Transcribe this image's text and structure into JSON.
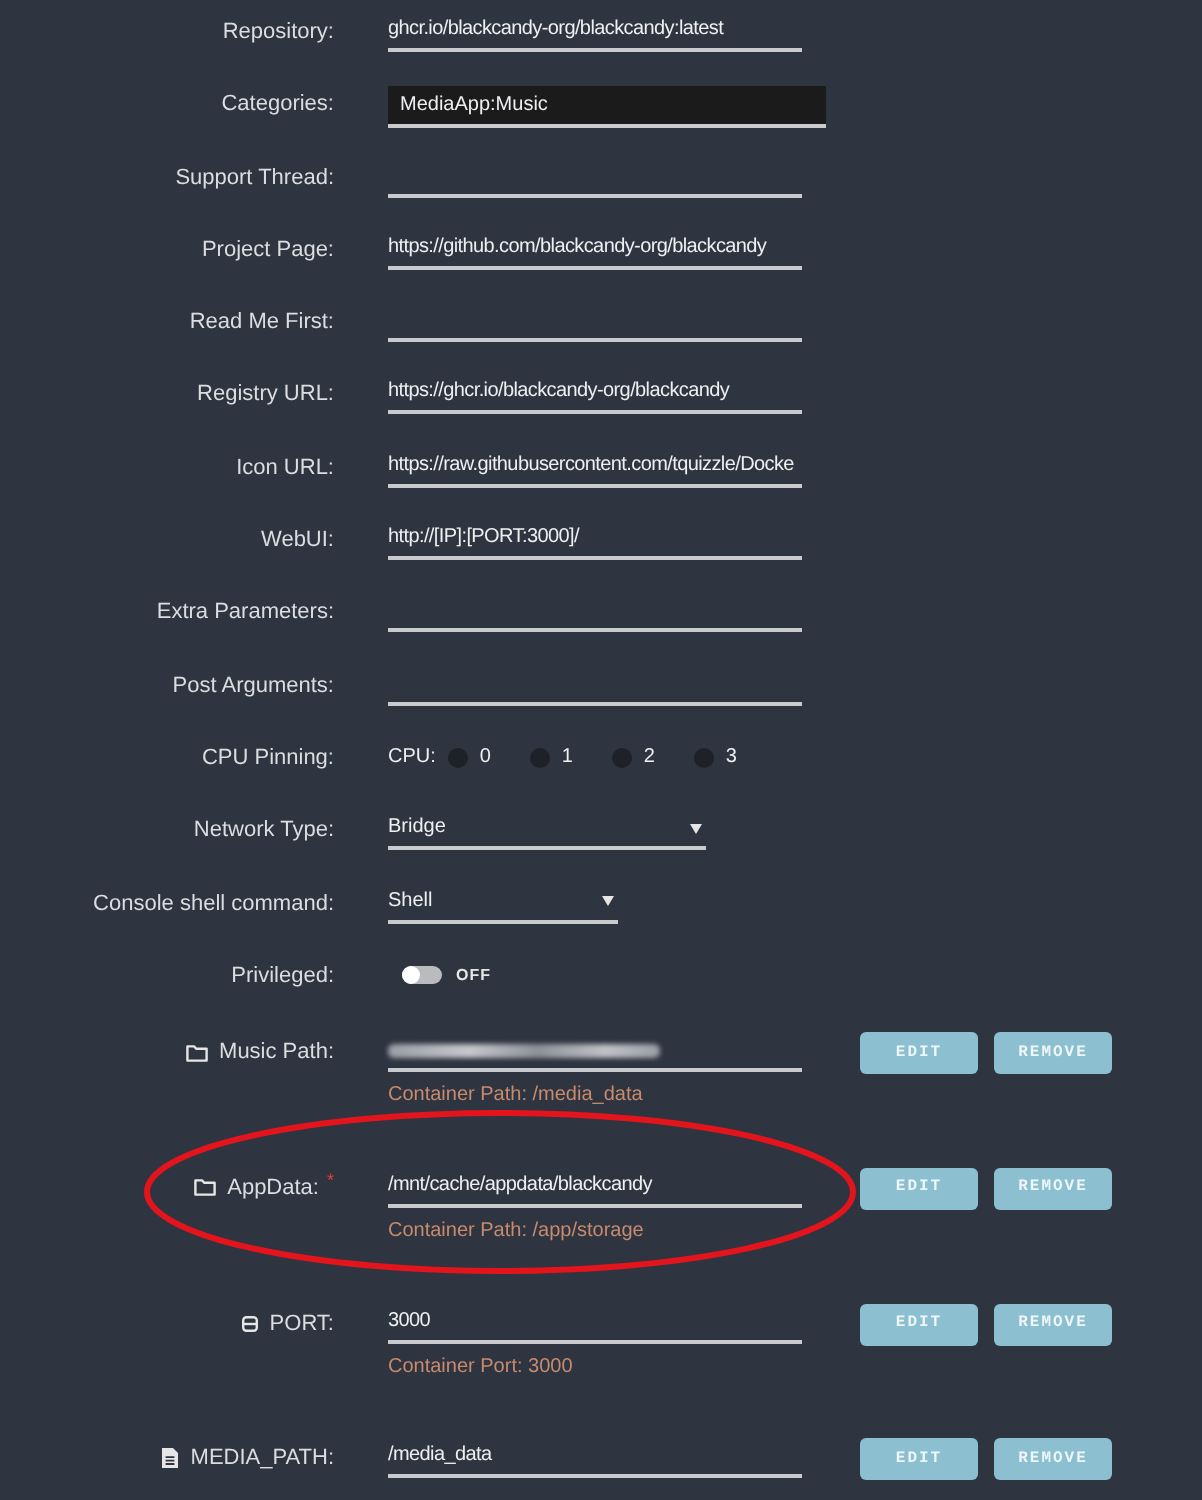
{
  "settings": [
    {
      "kind": "text",
      "label": "Repository:",
      "value": "ghcr.io/blackcandy-org/blackcandy:latest"
    },
    {
      "kind": "multiselect",
      "label": "Categories:",
      "value": "MediaApp:Music"
    },
    {
      "kind": "text",
      "label": "Support Thread:"
    },
    {
      "kind": "text",
      "label": "Project Page:",
      "value": "https://github.com/blackcandy-org/blackcandy"
    },
    {
      "kind": "text",
      "label": "Read Me First:"
    },
    {
      "kind": "text",
      "label": "Registry URL:",
      "value": "https://ghcr.io/blackcandy-org/blackcandy"
    },
    {
      "kind": "text",
      "label": "Icon URL:",
      "value": "https://raw.githubusercontent.com/tquizzle/Docke"
    },
    {
      "kind": "text",
      "label": "WebUI:",
      "value": "http://[IP]:[PORT:3000]/"
    },
    {
      "kind": "text",
      "label": "Extra Parameters:"
    },
    {
      "kind": "text",
      "label": "Post Arguments:"
    },
    {
      "kind": "cpu",
      "label": "CPU Pinning:",
      "prefix": "CPU:",
      "cpus": [
        {
          "label": "0",
          "checked": false
        },
        {
          "label": "1",
          "checked": false
        },
        {
          "label": "2",
          "checked": false
        },
        {
          "label": "3",
          "checked": false
        }
      ]
    },
    {
      "kind": "select",
      "label": "Network Type:",
      "value": "Bridge"
    },
    {
      "kind": "select",
      "label": "Console shell command:",
      "value": "Shell"
    },
    {
      "kind": "toggle",
      "label": "Privileged:",
      "on": false,
      "state_text": "OFF"
    }
  ],
  "mappings": [
    {
      "kind": "path",
      "label": "Music Path:",
      "redacted": true,
      "note": "Container Path: /media_data",
      "highlighted": false,
      "buttons": [
        "EDIT",
        "REMOVE"
      ]
    },
    {
      "kind": "path",
      "label": "AppData:",
      "required_mark": "*",
      "redacted": false,
      "value": "/mnt/cache/appdata/blackcandy",
      "note": "Container Path: /app/storage",
      "highlighted": true,
      "buttons": [
        "EDIT",
        "REMOVE"
      ]
    },
    {
      "kind": "port",
      "label": "PORT:",
      "redacted": false,
      "value": "3000",
      "note": "Container Port: 3000",
      "highlighted": false,
      "buttons": [
        "EDIT",
        "REMOVE"
      ]
    },
    {
      "kind": "variable",
      "label": "MEDIA_PATH:",
      "redacted": false,
      "value": "/media_data",
      "highlighted": false,
      "buttons": [
        "EDIT",
        "REMOVE"
      ]
    }
  ]
}
